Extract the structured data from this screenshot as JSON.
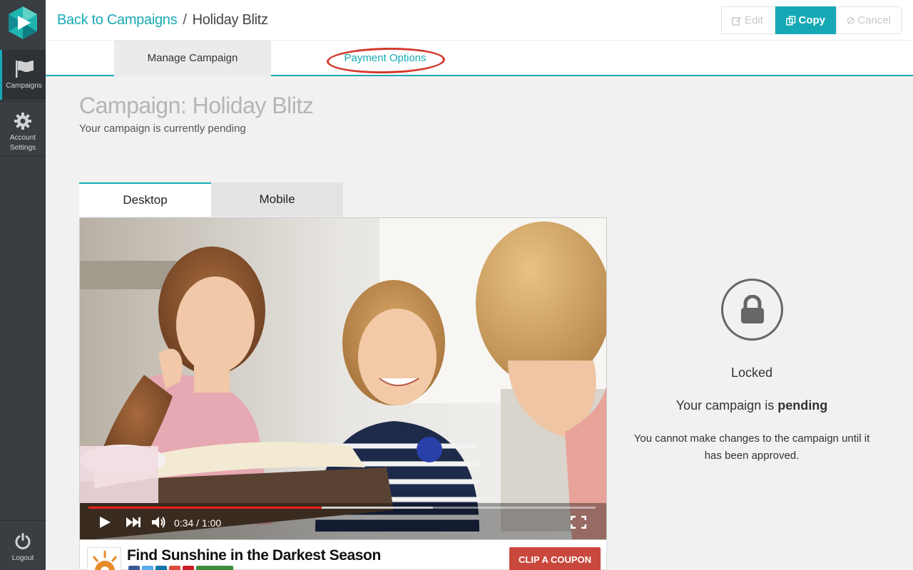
{
  "sidebar": {
    "items": [
      {
        "label": "Campaigns"
      },
      {
        "label": "Account Settings"
      }
    ],
    "logout_label": "Logout"
  },
  "header": {
    "back_link": "Back to Campaigns",
    "separator": "/",
    "current": "Holiday Blitz",
    "buttons": {
      "edit": "Edit",
      "copy": "Copy",
      "cancel": "Cancel"
    }
  },
  "tabs": {
    "manage": "Manage Campaign",
    "payment": "Payment Options"
  },
  "page": {
    "title": "Campaign: Holiday Blitz",
    "subtitle": "Your campaign is currently pending"
  },
  "device_tabs": {
    "desktop": "Desktop",
    "mobile": "Mobile"
  },
  "video": {
    "time": "0:34 / 1:00",
    "played_fraction": 0.46
  },
  "ad": {
    "title": "Find Sunshine in the Darkest Season",
    "cta": "CLIP A COUPON",
    "share_colors": [
      "#3b5998",
      "#55acee",
      "#0e76a8",
      "#dd4b39",
      "#cb2027",
      "#3c8d3c"
    ]
  },
  "lock_panel": {
    "status": "Locked",
    "pending_prefix": "Your campaign is",
    "pending_word": "pending",
    "message": "You cannot make changes to the campaign until it has been approved."
  },
  "colors": {
    "accent": "#16a9b5",
    "sidebar": "#3a3d42",
    "annotation": "#d3382b",
    "cta": "#c9483d"
  }
}
